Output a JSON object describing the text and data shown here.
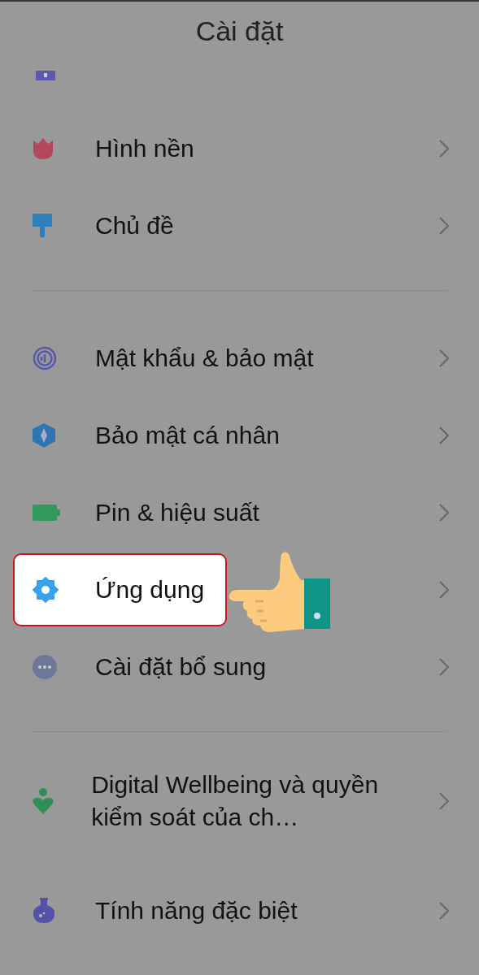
{
  "header": {
    "title": "Cài đặt"
  },
  "sections": [
    {
      "items": [
        {
          "label": "Hình nền",
          "selected": false
        },
        {
          "label": "Chủ đề",
          "selected": false
        }
      ]
    },
    {
      "items": [
        {
          "label": "Mật khẩu & bảo mật",
          "selected": false
        },
        {
          "label": "Bảo mật cá nhân",
          "selected": false
        },
        {
          "label": "Pin & hiệu suất",
          "selected": false
        },
        {
          "label": "Ứng dụng",
          "selected": true
        },
        {
          "label": "Cài đặt bổ sung",
          "selected": false
        }
      ]
    },
    {
      "items": [
        {
          "label": "Digital Wellbeing và quyền kiểm soát của ch…",
          "selected": false
        },
        {
          "label": "Tính năng đặc biệt",
          "selected": false
        }
      ]
    }
  ]
}
